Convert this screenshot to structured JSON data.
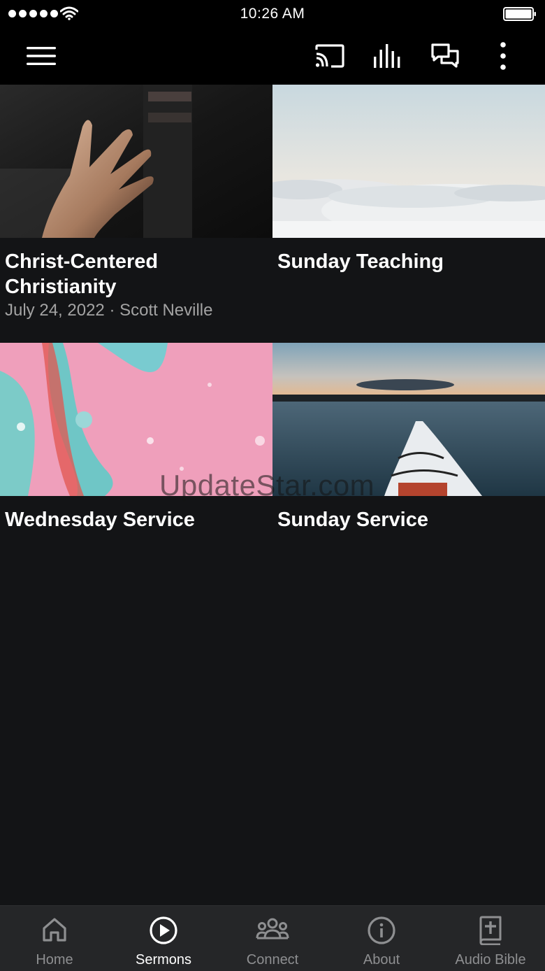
{
  "status_bar": {
    "time": "10:26 AM"
  },
  "toolbar": {
    "menu_icon": "hamburger-menu-icon",
    "actions": [
      "cast-icon",
      "audio-bars-icon",
      "chat-bubbles-icon",
      "more-vertical-icon"
    ]
  },
  "sermons": [
    {
      "title": "Christ-Centered Christianity",
      "meta": "July 24, 2022 · Scott Neville",
      "thumbnail": "open-hand-photo"
    },
    {
      "title": "Sunday Teaching",
      "meta": "",
      "thumbnail": "above-clouds-photo"
    },
    {
      "title": "Wednesday Service",
      "meta": "",
      "thumbnail": "pink-teal-paint-photo"
    },
    {
      "title": "Sunday Service",
      "meta": "",
      "thumbnail": "kayak-lake-photo"
    }
  ],
  "watermark": "UpdateStar.com",
  "tabs": [
    {
      "label": "Home",
      "icon": "home-icon",
      "active": false
    },
    {
      "label": "Sermons",
      "icon": "play-circle-icon",
      "active": true
    },
    {
      "label": "Connect",
      "icon": "people-group-icon",
      "active": false
    },
    {
      "label": "About",
      "icon": "info-circle-icon",
      "active": false
    },
    {
      "label": "Audio Bible",
      "icon": "bible-cross-icon",
      "active": false
    }
  ],
  "colors": {
    "background": "#131416",
    "bars": "#000000",
    "tabbar": "#252628",
    "inactive_tab": "#8e8f91",
    "meta_text": "#a3a3a3"
  }
}
